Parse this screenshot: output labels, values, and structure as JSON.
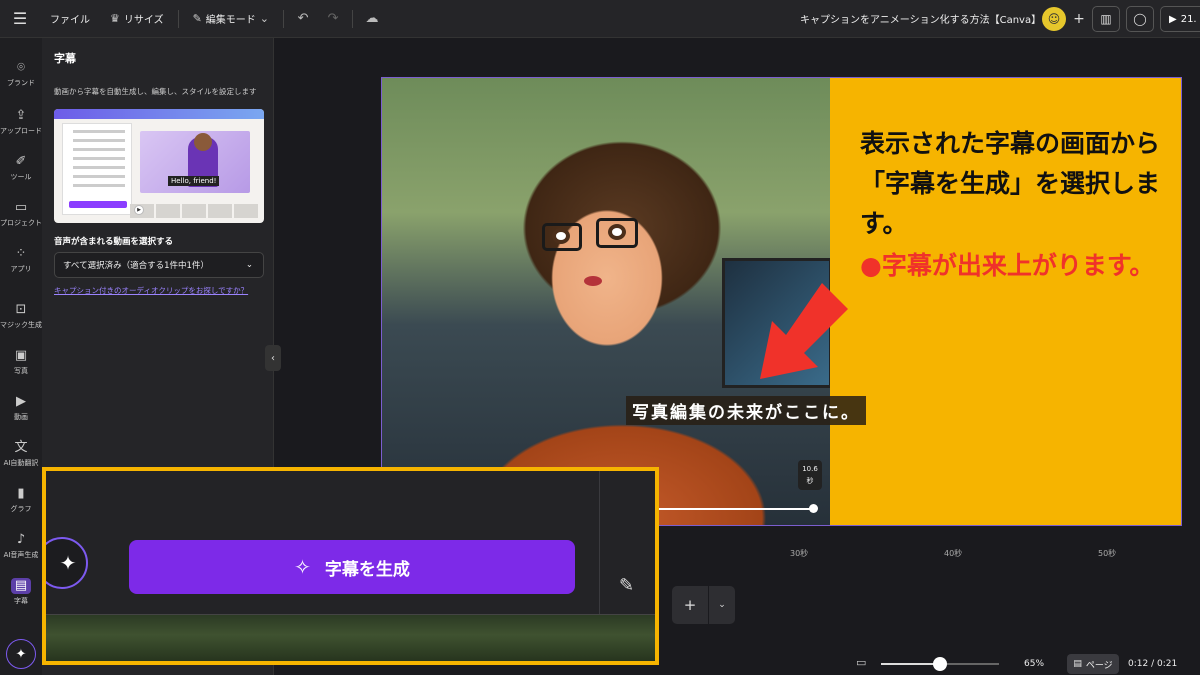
{
  "topbar": {
    "file": "ファイル",
    "resize": "リサイズ",
    "edit_mode": "編集モード",
    "doc_title": "キャプションをアニメーション化する方法【Canva】",
    "play_time": "21."
  },
  "rail": [
    {
      "label": "ブランド",
      "icon": "brand-icon"
    },
    {
      "label": "アップロード",
      "icon": "upload-icon"
    },
    {
      "label": "ツール",
      "icon": "tools-icon"
    },
    {
      "label": "プロジェクト",
      "icon": "folder-icon"
    },
    {
      "label": "アプリ",
      "icon": "apps-icon"
    },
    {
      "label": "マジック生成",
      "icon": "magic-media-icon"
    },
    {
      "label": "写真",
      "icon": "photo-icon"
    },
    {
      "label": "動画",
      "icon": "video-icon"
    },
    {
      "label": "AI自動翻訳",
      "icon": "translate-icon"
    },
    {
      "label": "グラフ",
      "icon": "chart-icon"
    },
    {
      "label": "AI音声生成",
      "icon": "voice-icon"
    },
    {
      "label": "字幕",
      "icon": "captions-icon"
    }
  ],
  "panel": {
    "title": "字幕",
    "description": "動画から字幕を自動生成し、編集し、スタイルを設定します",
    "thumb_caption": "Hello, friend!",
    "select_label": "音声が含まれる動画を選択する",
    "select_value": "すべて選択済み（適合する1件中1件）",
    "link": "キャプション付きのオーディオクリップをお探しですか？"
  },
  "canvas": {
    "subtitle": "写真編集の未来がここに。",
    "side_text": "表示された字幕の画面から「字幕を生成」を選択します。",
    "side_note": "●字幕が出来上がります。",
    "time_tip_value": "10.6",
    "time_tip_unit": "秒"
  },
  "ruler": [
    "30秒",
    "40秒",
    "50秒"
  ],
  "bottombar": {
    "zoom": "65%",
    "zoom_fraction": 0.5,
    "page_label": "ページ",
    "time": "0:12 / 0:21"
  },
  "callout": {
    "generate_button": "字幕を生成"
  },
  "colors": {
    "accent": "#7d2ae8",
    "highlight": "#f6b400",
    "note_red": "#f0322a"
  }
}
